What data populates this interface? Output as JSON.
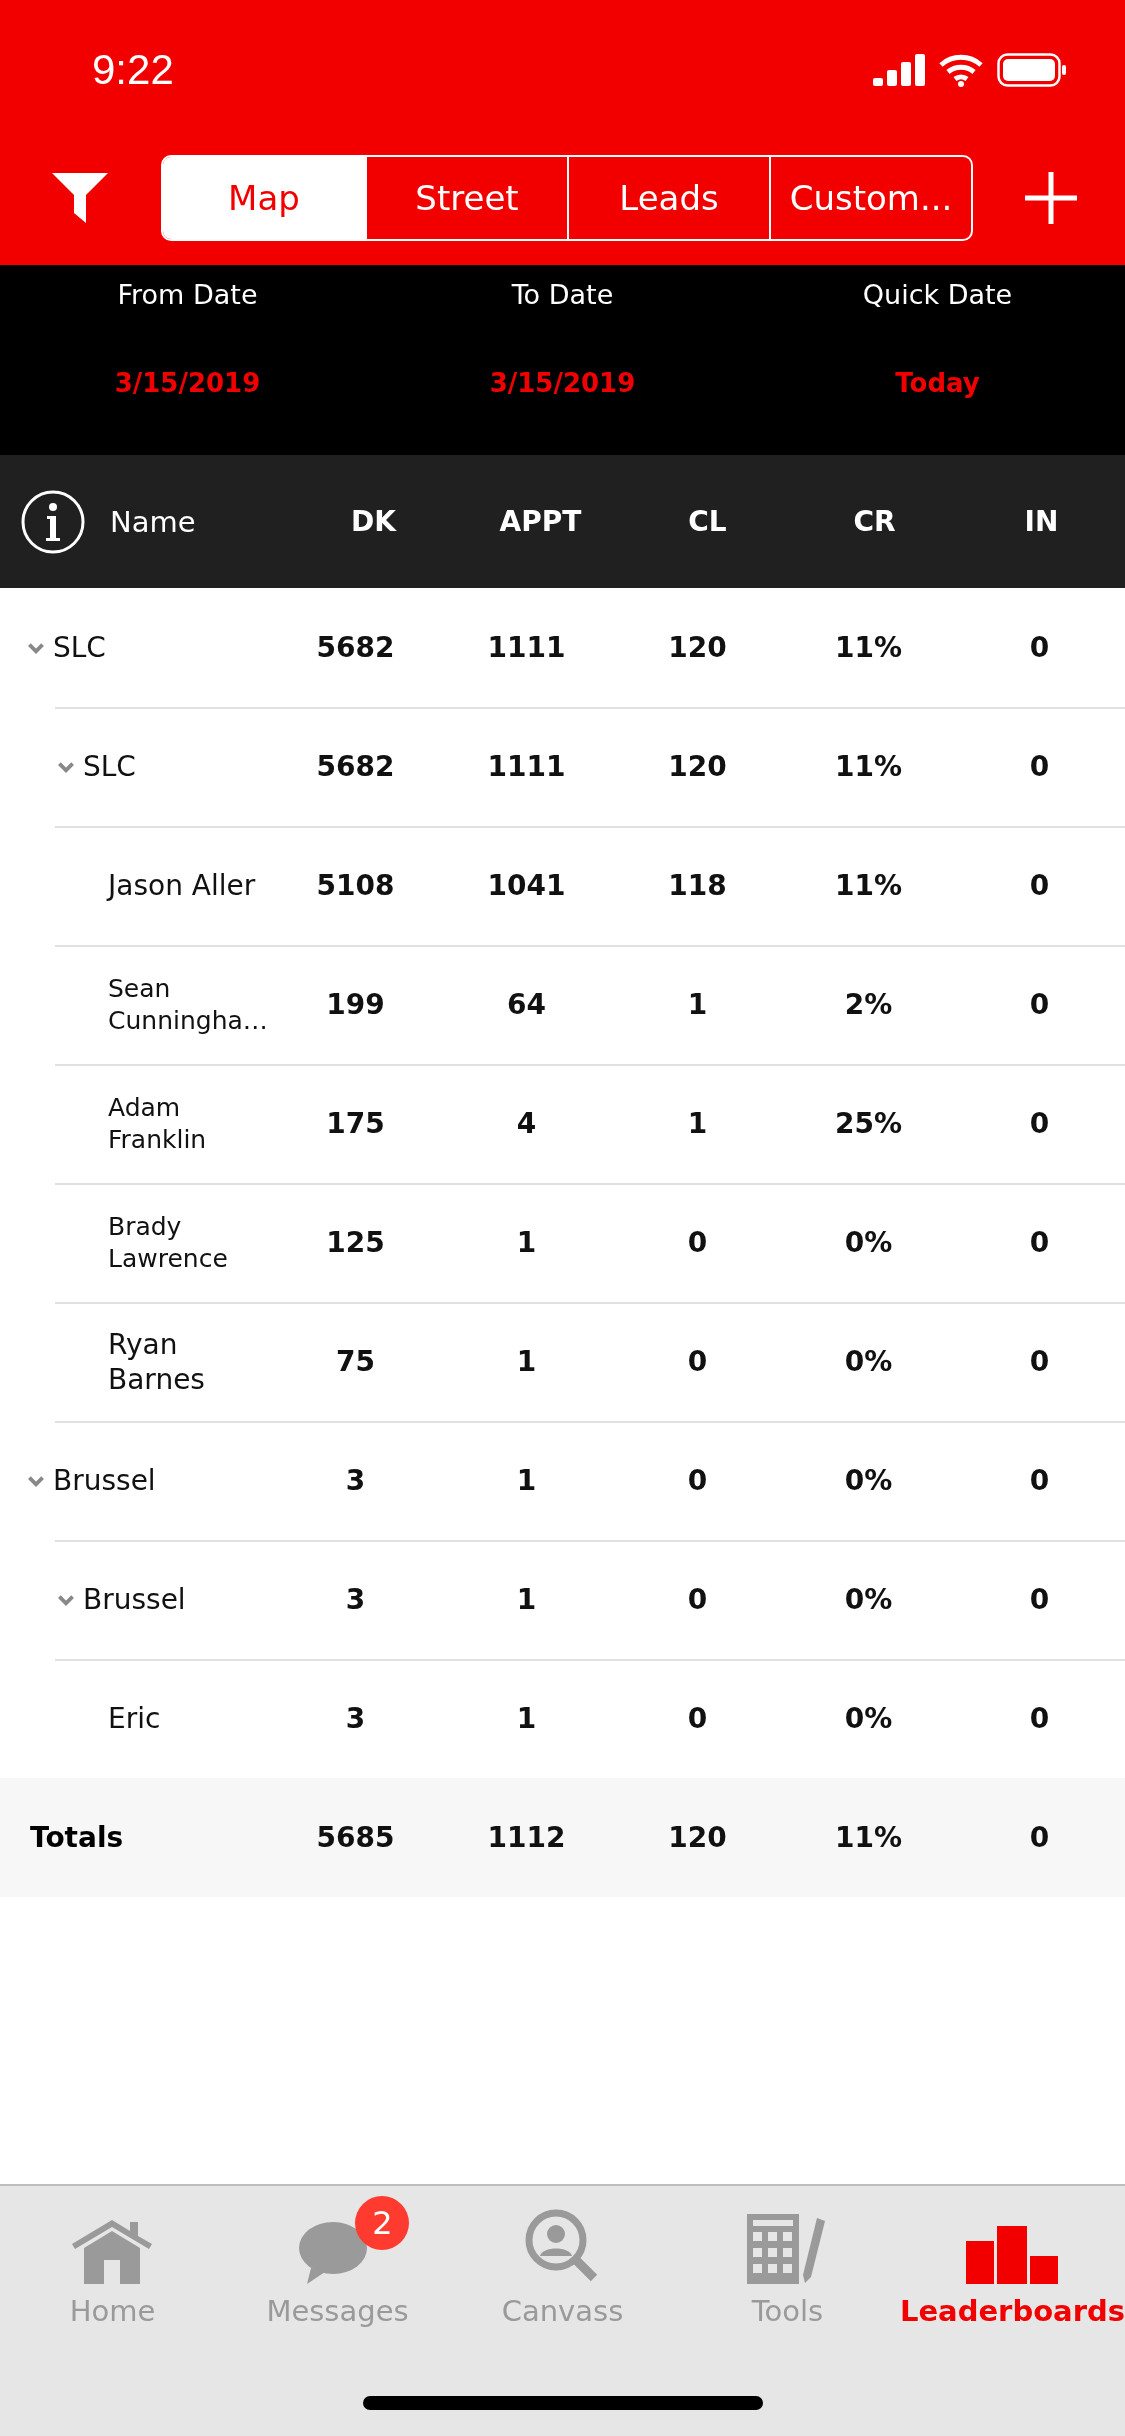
{
  "status_bar": {
    "time": "9:22"
  },
  "segments": [
    {
      "label": "Map",
      "selected": true
    },
    {
      "label": "Street",
      "selected": false
    },
    {
      "label": "Leads",
      "selected": false
    },
    {
      "label": "Custom...",
      "selected": false
    }
  ],
  "date_filters": [
    {
      "label": "From Date",
      "value": "3/15/2019"
    },
    {
      "label": "To Date",
      "value": "3/15/2019"
    },
    {
      "label": "Quick Date",
      "value": "Today"
    }
  ],
  "table": {
    "name_column": "Name",
    "columns": [
      "DK",
      "APPT",
      "CL",
      "CR",
      "IN"
    ],
    "rows": [
      {
        "name": "SLC",
        "values": [
          "5682",
          "1111",
          "120",
          "11%",
          "0"
        ],
        "expanded": true,
        "children": [
          {
            "name": "SLC",
            "values": [
              "5682",
              "1111",
              "120",
              "11%",
              "0"
            ],
            "expanded": true,
            "children": [
              {
                "name": "Jason Aller",
                "values": [
                  "5108",
                  "1041",
                  "118",
                  "11%",
                  "0"
                ]
              },
              {
                "name": "Sean Cunningha…",
                "values": [
                  "199",
                  "64",
                  "1",
                  "2%",
                  "0"
                ]
              },
              {
                "name": "Adam Franklin",
                "values": [
                  "175",
                  "4",
                  "1",
                  "25%",
                  "0"
                ]
              },
              {
                "name": "Brady Lawrence",
                "values": [
                  "125",
                  "1",
                  "0",
                  "0%",
                  "0"
                ]
              },
              {
                "name": "Ryan Barnes",
                "values": [
                  "75",
                  "1",
                  "0",
                  "0%",
                  "0"
                ]
              }
            ]
          }
        ]
      },
      {
        "name": "Brussel",
        "values": [
          "3",
          "1",
          "0",
          "0%",
          "0"
        ],
        "expanded": true,
        "children": [
          {
            "name": "Brussel",
            "values": [
              "3",
              "1",
              "0",
              "0%",
              "0"
            ],
            "expanded": true,
            "children": [
              {
                "name": "Eric",
                "values": [
                  "3",
                  "1",
                  "0",
                  "0%",
                  "0"
                ]
              }
            ]
          }
        ]
      }
    ],
    "totals": {
      "label": "Totals",
      "values": [
        "5685",
        "1112",
        "120",
        "11%",
        "0"
      ]
    }
  },
  "tab_bar": [
    {
      "label": "Home",
      "kind": "home",
      "selected": false
    },
    {
      "label": "Messages",
      "kind": "messages",
      "badge": "2",
      "selected": false
    },
    {
      "label": "Canvass",
      "kind": "canvass",
      "selected": false
    },
    {
      "label": "Tools",
      "kind": "tools",
      "selected": false
    },
    {
      "label": "Leaderboards",
      "kind": "leaderboards",
      "selected": true
    }
  ]
}
